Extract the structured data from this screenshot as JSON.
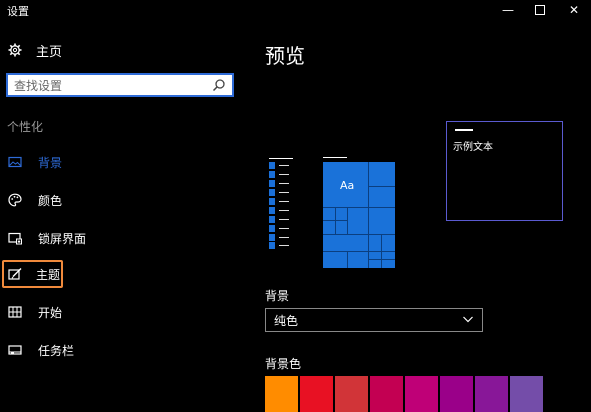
{
  "window": {
    "title": "设置",
    "controls": {
      "minimize": "—",
      "close": "✕"
    }
  },
  "nav": {
    "home_label": "主页",
    "search_placeholder": "查找设置",
    "section": "个性化",
    "items": [
      {
        "label": "背景",
        "icon": "image-icon",
        "selected": true
      },
      {
        "label": "颜色",
        "icon": "palette-icon"
      },
      {
        "label": "锁屏界面",
        "icon": "lock-screen-icon"
      },
      {
        "label": "主题",
        "icon": "theme-brush-icon",
        "highlighted": true
      },
      {
        "label": "开始",
        "icon": "start-grid-icon"
      },
      {
        "label": "任务栏",
        "icon": "taskbar-icon"
      }
    ]
  },
  "main": {
    "preview_title": "预览",
    "sample_text": "示例文本",
    "tile_text": "Aa",
    "background_label": "背景",
    "background_value": "纯色",
    "background_color_label": "背景色",
    "swatches": [
      "#ff8c00",
      "#e81123",
      "#d13438",
      "#c30052",
      "#bf0077",
      "#9a0089",
      "#881798",
      "#744da9"
    ]
  },
  "colors": {
    "accent": "#2e6bd7",
    "tile_blue": "#1a72d9",
    "highlight_box": "#f08a3c"
  }
}
